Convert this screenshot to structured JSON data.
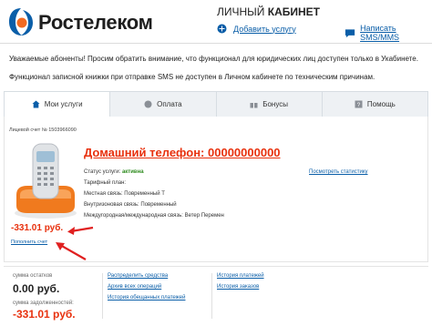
{
  "header": {
    "brand": "Ростелеком",
    "cabinet_prefix": "ЛИЧНЫЙ",
    "cabinet_bold": "КАБИНЕТ",
    "add_service": "Добавить услугу",
    "write_sms": "Написать SMS/MMS",
    "colors": {
      "logo_blue": "#0a5ea8",
      "logo_orange": "#f26a21",
      "accent_red": "#e8310e",
      "link": "#0a5ea8"
    }
  },
  "notices": [
    "Уважаемые абоненты! Просим обратить внимание, что функционал для юридических лиц доступен только в Укабинете.",
    "Функционал записной книжки при отправке SMS не доступен в Личном кабинете по техническим причинам."
  ],
  "tabs": [
    {
      "label": "Мои услуги",
      "icon": "home-icon"
    },
    {
      "label": "Оплата",
      "icon": "wallet-icon"
    },
    {
      "label": "Бонусы",
      "icon": "gift-icon"
    },
    {
      "label": "Помощь",
      "icon": "help-icon"
    }
  ],
  "account": {
    "label": "Лицевой счет № 1503966090"
  },
  "service": {
    "title": "Домашний телефон: 00000000000",
    "status_label": "Статус услуги: ",
    "status_value": "активна",
    "tariff": "Тарифный план:",
    "local": "Местная связь: Повременный Т",
    "intrazonal": "Внутризоновая связь: Повременный",
    "longdistance": "Междугородная/международная связь: Ветер Перемен",
    "stats_link": "Посмотреть статистику",
    "balance": "-331.01 руб.",
    "topup_link": "Пополнить счет"
  },
  "bottom": {
    "remaining_label": "сумма остатков",
    "remaining_value": "0.00 руб.",
    "debt_label": "сумма задолженностей:",
    "debt_value": "-331.01 руб.",
    "links_col1": [
      "Распределить средства",
      "Архив всех операций",
      "История обещанных платежей"
    ],
    "links_col2": [
      "История платежей",
      "История заказов"
    ]
  }
}
